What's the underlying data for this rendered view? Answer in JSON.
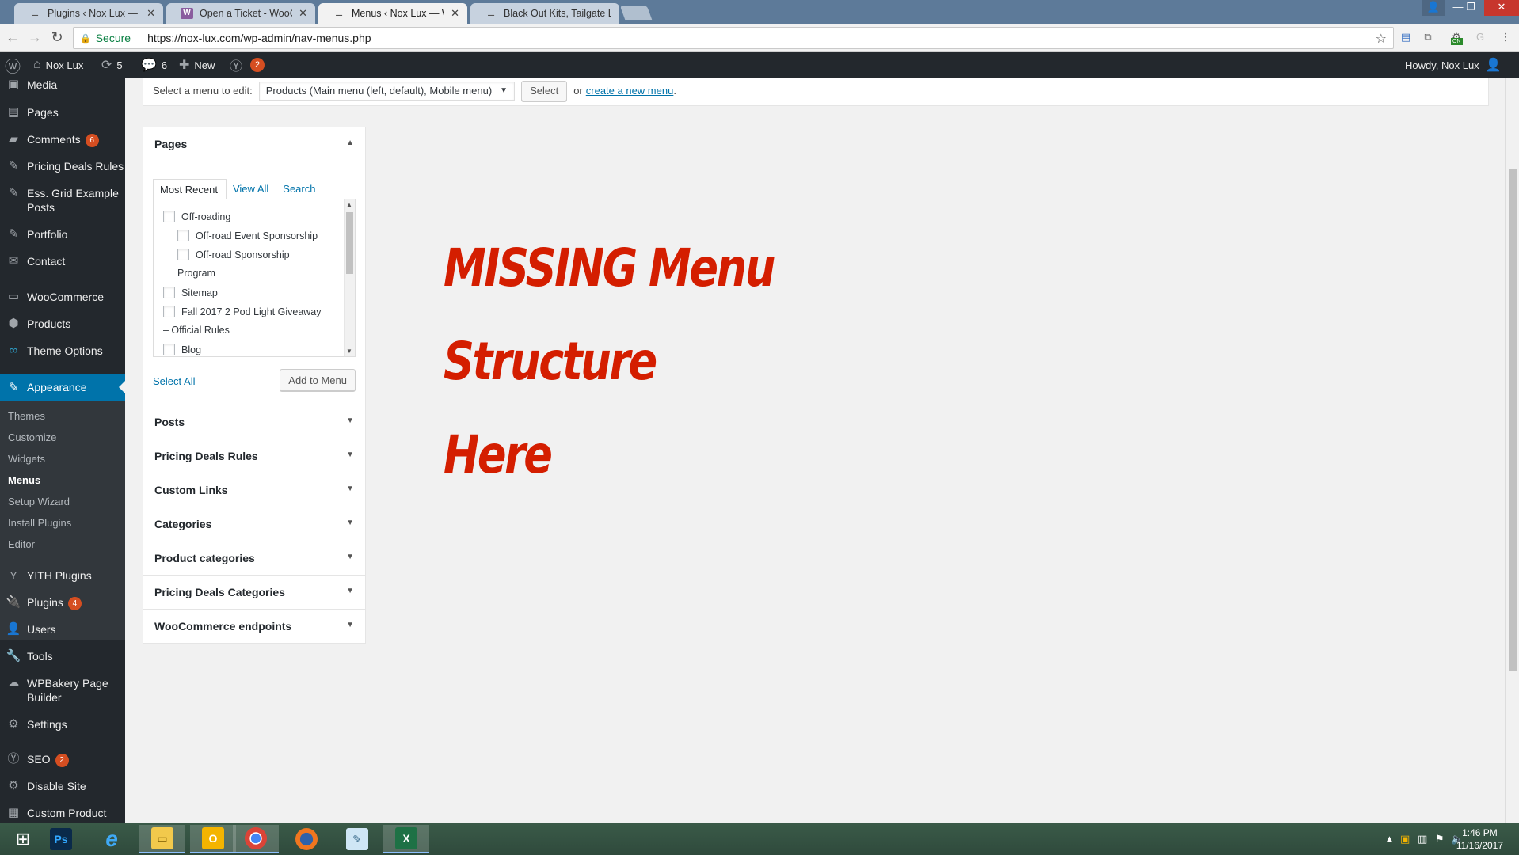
{
  "browser": {
    "tabs": [
      {
        "title": "Plugins ‹ Nox Lux — Wo",
        "active": false
      },
      {
        "title": "Open a Ticket - WooCom",
        "active": false
      },
      {
        "title": "Menus ‹ Nox Lux — Wor",
        "active": true
      },
      {
        "title": "Black Out Kits, Tailgate Li",
        "active": false
      }
    ],
    "close_glyph": "✕",
    "secure_label": "Secure",
    "url": "https://nox-lux.com/wp-admin/nav-menus.php",
    "extension_badge": "ON"
  },
  "adminbar": {
    "site_name": "Nox Lux",
    "updates_count": "5",
    "comments_count": "6",
    "new_label": "New",
    "yoast_badge": "2",
    "howdy": "Howdy, Nox Lux"
  },
  "sidebar": {
    "items_top": [
      {
        "label": "Media",
        "icon": "media-icon"
      },
      {
        "label": "Pages",
        "icon": "pages-icon"
      },
      {
        "label": "Comments",
        "icon": "comments-icon",
        "badge": "6"
      },
      {
        "label": "Pricing Deals Rules",
        "icon": "pin-icon"
      },
      {
        "label": "Ess. Grid Example Posts",
        "icon": "pin-icon"
      },
      {
        "label": "Portfolio",
        "icon": "pin-icon"
      },
      {
        "label": "Contact",
        "icon": "mail-icon"
      },
      {
        "label": "WooCommerce",
        "icon": "woocommerce-icon"
      },
      {
        "label": "Products",
        "icon": "products-icon"
      },
      {
        "label": "Theme Options",
        "icon": "theme-options-icon"
      }
    ],
    "current": {
      "label": "Appearance",
      "icon": "appearance-icon"
    },
    "submenu": [
      "Themes",
      "Customize",
      "Widgets",
      "Menus",
      "Setup Wizard",
      "Install Plugins",
      "Editor"
    ],
    "submenu_current": "Menus",
    "items_bottom": [
      {
        "label": "YITH Plugins",
        "icon": "yith-icon"
      },
      {
        "label": "Plugins",
        "icon": "plugins-icon",
        "badge": "4"
      },
      {
        "label": "Users",
        "icon": "users-icon"
      },
      {
        "label": "Tools",
        "icon": "tools-icon"
      },
      {
        "label": "WPBakery Page Builder",
        "icon": "wpbakery-icon"
      },
      {
        "label": "Settings",
        "icon": "settings-icon"
      },
      {
        "label": "SEO",
        "icon": "seo-icon",
        "badge": "2"
      },
      {
        "label": "Disable Site",
        "icon": "disable-site-icon"
      },
      {
        "label": "Custom Product",
        "icon": "custom-product-icon"
      }
    ]
  },
  "manage": {
    "prompt": "Select a menu to edit:",
    "selected_menu": "Products (Main menu (left, default), Mobile menu)",
    "select_button": "Select",
    "or_text": "or",
    "create_link": "create a new menu",
    "period": "."
  },
  "pages_panel": {
    "title": "Pages",
    "tabs": [
      "Most Recent",
      "View All",
      "Search"
    ],
    "items": [
      {
        "label": "Off-roading",
        "checkbox": true
      },
      {
        "label": "Off-road Event Sponsorship",
        "checkbox": true
      },
      {
        "label": "Off-road Sponsorship",
        "checkbox": true
      },
      {
        "label": "Program",
        "checkbox": false
      },
      {
        "label": "Sitemap",
        "checkbox": true
      },
      {
        "label": "Fall 2017 2 Pod Light Giveaway",
        "checkbox": true
      },
      {
        "label": "– Official Rules",
        "checkbox": false
      },
      {
        "label": "Blog",
        "checkbox": true
      }
    ],
    "select_all": "Select All",
    "add_to_menu": "Add to Menu"
  },
  "other_panels": [
    "Posts",
    "Pricing Deals Rules",
    "Custom Links",
    "Categories",
    "Product categories",
    "Pricing Deals Categories",
    "WooCommerce endpoints"
  ],
  "annotation": {
    "line1": "MISSING Menu Structure",
    "line2": "Here",
    "color": "#d41e00"
  },
  "taskbar": {
    "time": "1:46 PM",
    "date": "11/16/2017",
    "apps": [
      "windows-start-icon",
      "photoshop-icon",
      "internet-explorer-icon",
      "file-explorer-icon",
      "outlook-icon",
      "chrome-icon",
      "firefox-icon",
      "notepad-icon",
      "excel-icon"
    ]
  },
  "colors": {
    "admin_bar": "#23282d",
    "accent": "#0073aa",
    "badge": "#d54e21"
  }
}
